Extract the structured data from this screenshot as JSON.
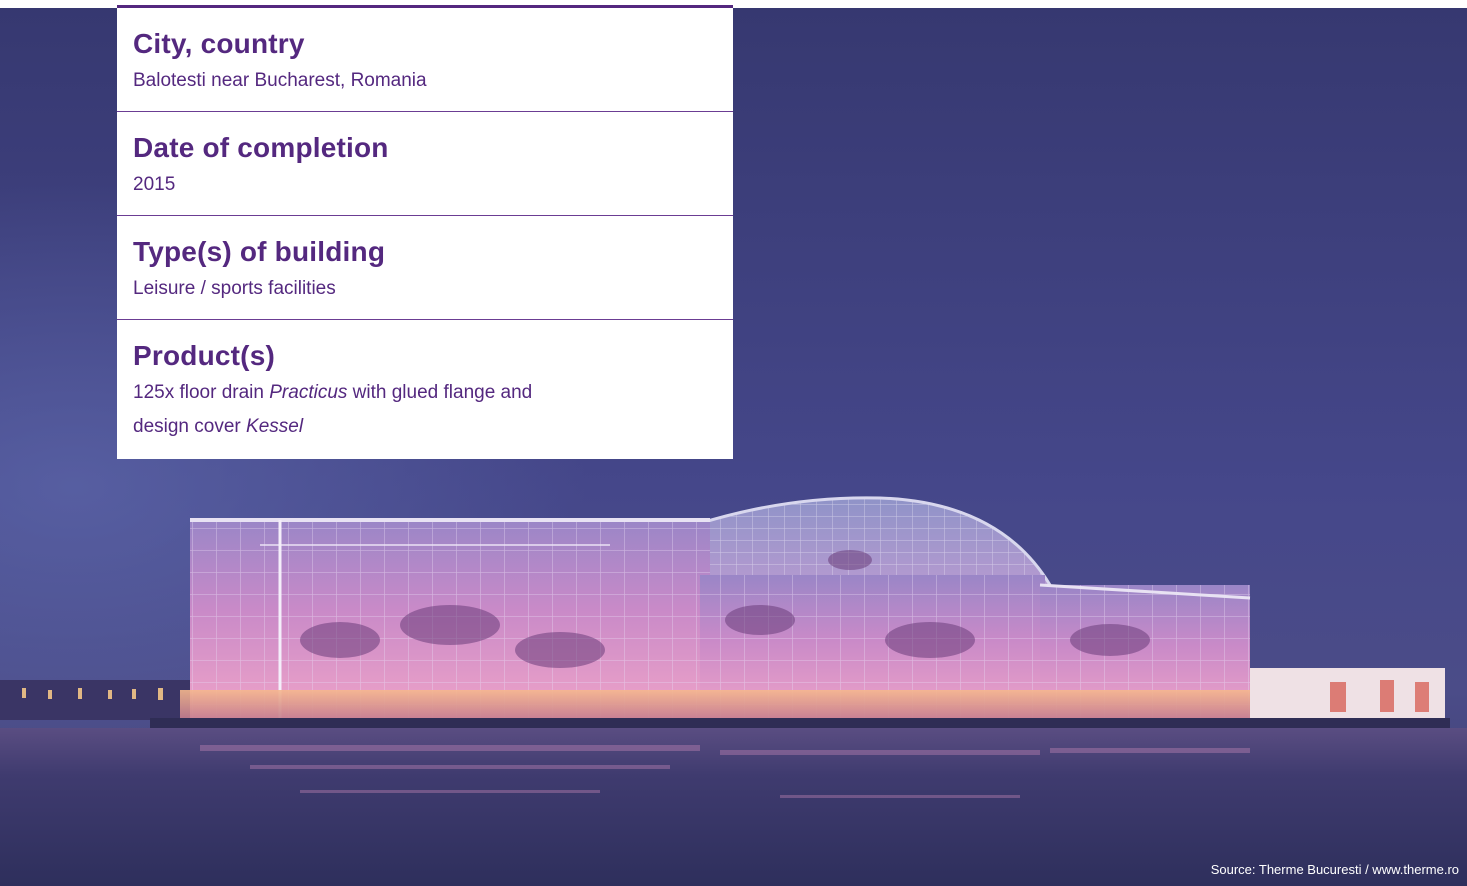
{
  "info": {
    "city_heading": "City, country",
    "city_value": "Balotesti near Bucharest, Romania",
    "date_heading": "Date of completion",
    "date_value": "2015",
    "type_heading": "Type(s) of building",
    "type_value": "Leisure / sports facilities",
    "product_heading": "Product(s)",
    "product_value_1": "125x floor drain ",
    "product_value_italic_1": "Practicus",
    "product_value_2": " with glued flange and",
    "product_value_3": "design cover ",
    "product_value_italic_2": "Kessel"
  },
  "credit": {
    "source_text": "Source: Therme Bucuresti / www.therme.ro"
  },
  "colors": {
    "accent": "#54287f",
    "sky_top": "#35356e",
    "water": "#3a3566",
    "glow": "#e59ad0"
  }
}
